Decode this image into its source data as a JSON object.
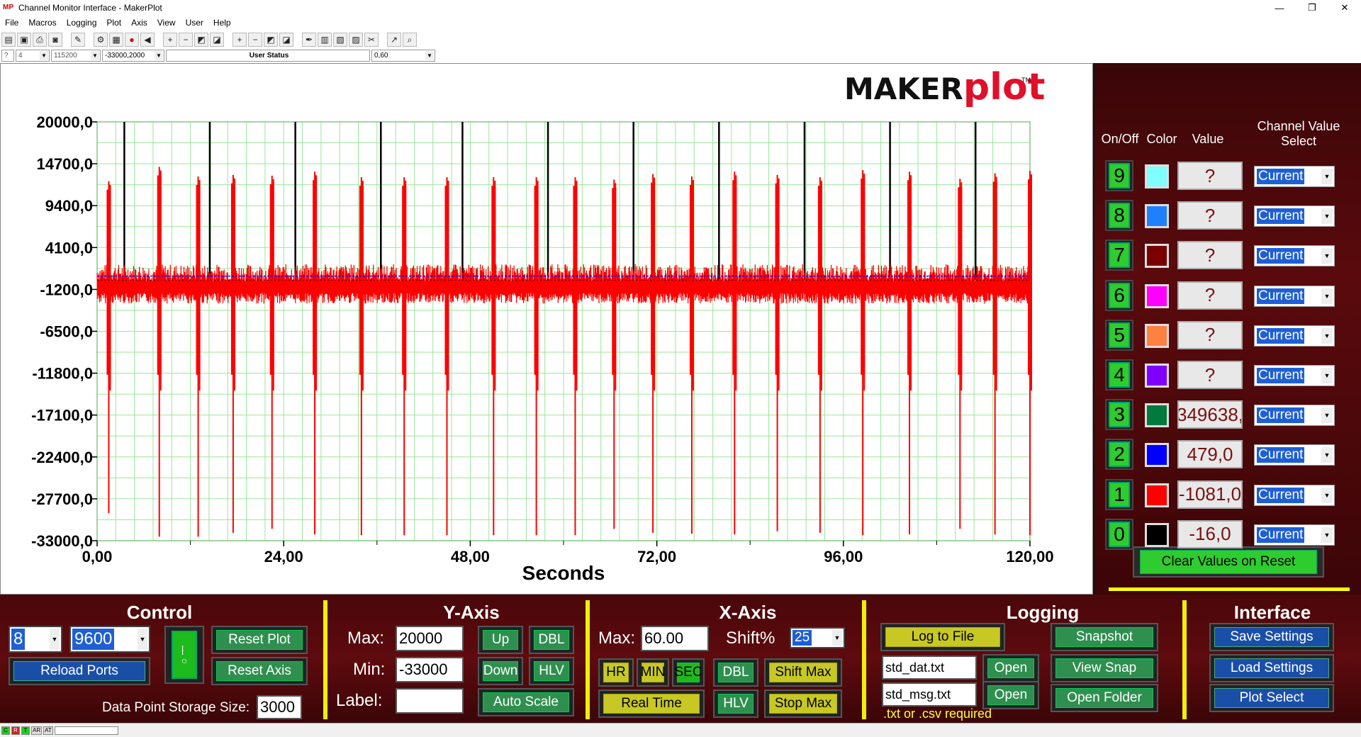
{
  "window": {
    "title": "Channel Monitor Interface - MakerPlot",
    "app_icon": "MP",
    "controls": [
      "—",
      "❐",
      "✕"
    ]
  },
  "menu": [
    "File",
    "Macros",
    "Logging",
    "Plot",
    "Axis",
    "View",
    "User",
    "Help"
  ],
  "statusbar": {
    "help": "?",
    "port": "4",
    "baud": "115200",
    "y_range": "-33000,2000",
    "user_status": "User Status",
    "x_range": "0,60"
  },
  "logo": {
    "maker": "MAKER",
    "plot": "plot",
    "tm": "TM"
  },
  "chart_data": {
    "type": "line",
    "xlabel": "Seconds",
    "ylabel": "",
    "xlim": [
      0,
      120
    ],
    "ylim": [
      -33000,
      20000
    ],
    "grid": true,
    "x_ticks": [
      "0,00",
      "24,00",
      "48,00",
      "72,00",
      "96,00",
      "120,00"
    ],
    "y_ticks": [
      "20000,0",
      "14700,0",
      "9400,0",
      "4100,0",
      "-1200,0",
      "-6500,0",
      "-11800,0",
      "-17100,0",
      "-22400,0",
      "-27700,0",
      "-33000,0"
    ],
    "series": [
      {
        "color": "#ff0000",
        "baseline": -1081,
        "noise_band": [
          -3000,
          2000
        ],
        "spike_x": [
          1.5,
          8.0,
          13.0,
          17.5,
          22.5,
          28.0,
          34.0,
          39.5,
          45.0,
          51.0,
          56.5,
          61.5,
          66.5,
          71.5,
          76.5,
          82.0,
          87.5,
          93.0,
          98.5,
          104.5,
          111.0,
          115.5,
          120.0
        ],
        "spike_high": [
          12500,
          14300,
          13100,
          13300,
          13200,
          13700,
          13000,
          13000,
          13000,
          13000,
          13000,
          13000,
          12700,
          13400,
          13100,
          13700,
          13300,
          13000,
          13900,
          13700,
          12800,
          13500,
          13800
        ],
        "spike_low": [
          -29500,
          -32500,
          -32500,
          -32000,
          -31500,
          -32200,
          -32300,
          -32300,
          -32300,
          -32300,
          -32300,
          -32300,
          -31500,
          -32000,
          -32100,
          -32200,
          -31800,
          -32000,
          -32300,
          -32200,
          -31500,
          -32200,
          -32300
        ]
      },
      {
        "color": "#000000",
        "baseline": -16,
        "spike_x": [
          3.5,
          14.5,
          25.5,
          36.5,
          47.0,
          58.0,
          69.0,
          80.0,
          91.0,
          102.0,
          113.0
        ],
        "spike_high": [
          20000,
          20000,
          20000,
          20000,
          20000,
          20000,
          20000,
          20000,
          20000,
          20000,
          20000
        ]
      },
      {
        "color": "#0000ff",
        "baseline": 479
      }
    ]
  },
  "channel_panel": {
    "headers": {
      "onoff": "On/Off",
      "color": "Color",
      "value": "Value",
      "select1": "Channel Value",
      "select2": "Select"
    },
    "channels": [
      {
        "num": "9",
        "color": "#80ffff",
        "value": "?",
        "select": "Current"
      },
      {
        "num": "8",
        "color": "#1e7fff",
        "value": "?",
        "select": "Current"
      },
      {
        "num": "7",
        "color": "#7a0000",
        "value": "?",
        "select": "Current"
      },
      {
        "num": "6",
        "color": "#ff00ff",
        "value": "?",
        "select": "Current"
      },
      {
        "num": "5",
        "color": "#ff8040",
        "value": "?",
        "select": "Current"
      },
      {
        "num": "4",
        "color": "#8000ff",
        "value": "?",
        "select": "Current"
      },
      {
        "num": "3",
        "color": "#007a3d",
        "value": "349638,",
        "select": "Current"
      },
      {
        "num": "2",
        "color": "#0000ff",
        "value": "479,0",
        "select": "Current"
      },
      {
        "num": "1",
        "color": "#ff0000",
        "value": "-1081,0",
        "select": "Current"
      },
      {
        "num": "0",
        "color": "#000000",
        "value": "-16,0",
        "select": "Current"
      }
    ],
    "clear_button": "Clear Values on Reset"
  },
  "control": {
    "title": "Control",
    "port": "8",
    "baud": "9600",
    "reset_plot": "Reset Plot",
    "reset_axis": "Reset Axis",
    "reload_ports": "Reload Ports",
    "storage_label": "Data Point Storage Size:",
    "storage_value": "3000"
  },
  "yaxis": {
    "title": "Y-Axis",
    "max_label": "Max:",
    "max_value": "20000",
    "min_label": "Min:",
    "min_value": "-33000",
    "label_label": "Label:",
    "label_value": "",
    "up": "Up",
    "dbl": "DBL",
    "down": "Down",
    "hlv": "HLV",
    "auto_scale": "Auto Scale"
  },
  "xaxis": {
    "title": "X-Axis",
    "max_label": "Max:",
    "max_value": "60.00",
    "shift_label": "Shift%",
    "shift_value": "25",
    "hr": "HR",
    "min": "MIN",
    "sec": "SEC",
    "dbl": "DBL",
    "shift_max": "Shift Max",
    "real_time": "Real Time",
    "hlv": "HLV",
    "stop_max": "Stop Max"
  },
  "logging": {
    "title": "Logging",
    "log_to_file": "Log to File",
    "snapshot": "Snapshot",
    "dat_file": "std_dat.txt",
    "msg_file": "std_msg.txt",
    "open1": "Open",
    "open2": "Open",
    "view_snap": "View Snap",
    "open_folder": "Open Folder",
    "note": ".txt or .csv required"
  },
  "interface": {
    "title": "Interface",
    "save_settings": "Save Settings",
    "load_settings": "Load Settings",
    "plot_select": "Plot Select"
  },
  "footer": {
    "items": [
      "C",
      "R",
      "T",
      "AR",
      "AT"
    ]
  }
}
